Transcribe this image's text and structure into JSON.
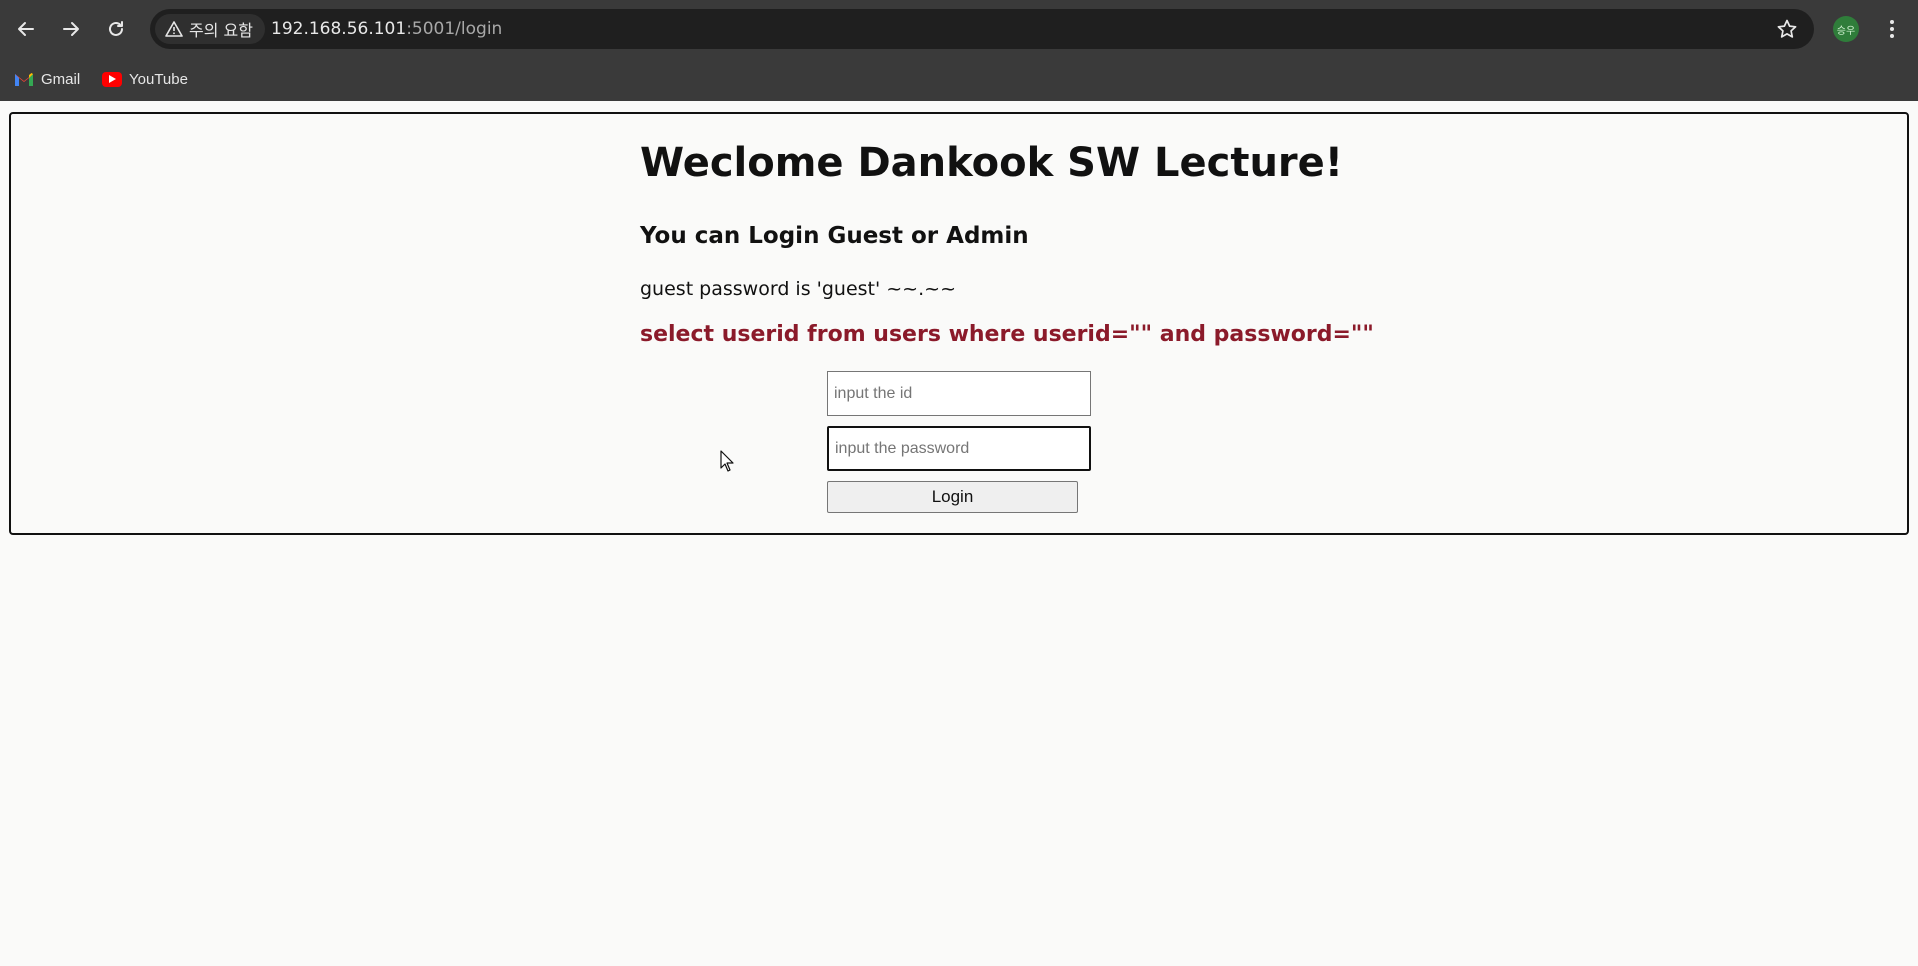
{
  "browser": {
    "security_label": "주의 요함",
    "url_host": "192.168.56.101",
    "url_rest": ":5001/login",
    "profile_initials": "승우",
    "bookmarks": [
      {
        "label": "Gmail",
        "icon": "gmail-icon"
      },
      {
        "label": "YouTube",
        "icon": "youtube-icon"
      }
    ]
  },
  "page": {
    "title": "Weclome Dankook SW Lecture!",
    "subtitle": "You can Login Guest or Admin",
    "hint": "guest password is 'guest' ~~.~~",
    "sql": "select userid from users where userid=\"\" and password=\"\"",
    "id_placeholder": "input the id",
    "password_placeholder": "input the password",
    "login_label": "Login"
  },
  "colors": {
    "chrome_bg": "#3a3a3a",
    "omnibox_bg": "#1f1f1f",
    "sql_text": "#8b1a2a",
    "page_bg": "#fafaf9"
  }
}
